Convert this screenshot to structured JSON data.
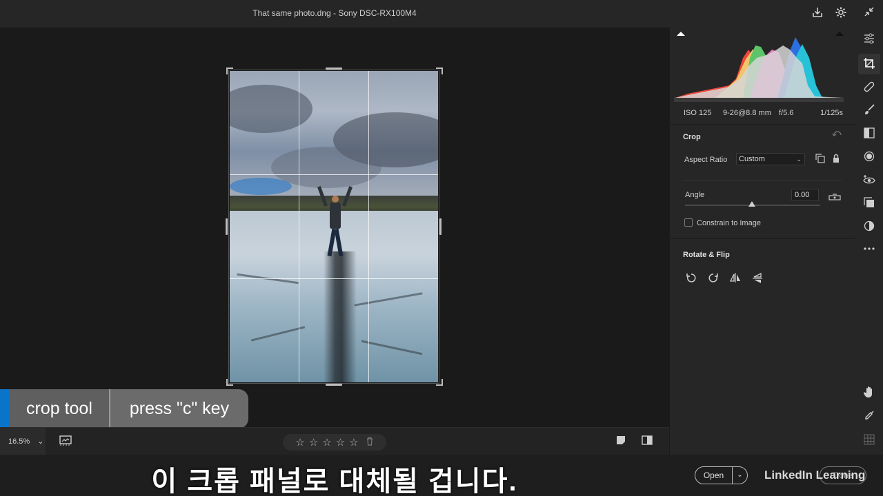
{
  "window": {
    "title": "That same photo.dng  -  Sony DSC-RX100M4"
  },
  "caption": {
    "tool_label": "crop tool",
    "shortcut_label": "press \"c\" key"
  },
  "bottom_bar": {
    "zoom_level": "16.5%",
    "zoom_caret": "⌄",
    "stars": [
      "☆",
      "☆",
      "☆",
      "☆",
      "☆"
    ],
    "trash": "🗑"
  },
  "subtitle": {
    "text": "이 크롭 패널로 대체될 겁니다."
  },
  "footer": {
    "open_label": "Open",
    "open_caret": "⌄",
    "brand": "LinkedIn Learning",
    "done_label": "Done"
  },
  "exif": {
    "iso": "ISO 125",
    "lens": "9-26@8.8 mm",
    "aperture": "f/5.6",
    "shutter": "1/125s"
  },
  "crop_panel": {
    "title": "Crop",
    "aspect_ratio_label": "Aspect Ratio",
    "aspect_ratio_value": "Custom",
    "angle_label": "Angle",
    "angle_value": "0.00",
    "constrain_label": "Constrain to Image",
    "constrain_checked": false
  },
  "rotate_panel": {
    "title": "Rotate & Flip"
  },
  "histogram_colors": {
    "red": "#f0473a",
    "yellow": "#f2c56a",
    "green": "#5ec46a",
    "magenta": "#e67ac2",
    "cyan": "#27c2d8",
    "blue": "#2b6fe0",
    "luminance": "#d6d6d6"
  },
  "icons": {
    "export": "export-icon",
    "settings": "gear-icon",
    "collapse": "collapse-icon",
    "edit": "sliders-icon",
    "crop": "crop-icon",
    "heal": "bandage-icon",
    "brush": "brush-icon",
    "gradient": "gradient-icon",
    "radial": "radial-icon",
    "redeye": "eye-icon",
    "presets": "presets-icon",
    "snapshots": "snapshots-icon",
    "more": "more-icon",
    "hand": "hand-icon",
    "sampler": "eyedropper-icon",
    "grid": "grid-icon"
  }
}
